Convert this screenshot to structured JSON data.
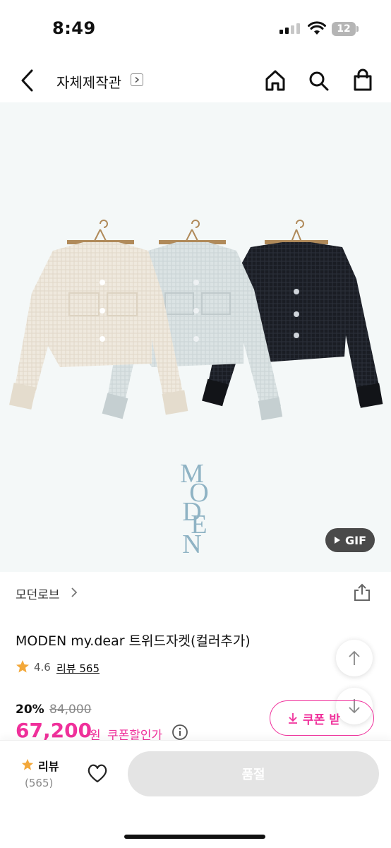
{
  "status_bar": {
    "time": "8:49",
    "battery": "12"
  },
  "header": {
    "title": "자체제작관"
  },
  "hero": {
    "brand_wordmark": [
      "M",
      "O",
      "D",
      "E",
      "N"
    ],
    "gif_label": "GIF"
  },
  "product": {
    "brand": "모던로브",
    "title": "MODEN my.dear 트위드자켓(컬러추가)",
    "rating": "4.6",
    "review_link": "리뷰 565",
    "discount": "20%",
    "original_price": "84,000",
    "price": "67,200",
    "currency": "원",
    "coupon_price_label": "쿠폰할인가",
    "coupon_button": "쿠폰 받",
    "jacket_colors": [
      "#efe9de",
      "#dbe3e4",
      "#1a1d24"
    ]
  },
  "bottom_bar": {
    "review_label": "리뷰",
    "review_count": "(565)",
    "cta": "품절"
  },
  "colors": {
    "accent": "#f0309b",
    "star": "#f3a83a"
  }
}
